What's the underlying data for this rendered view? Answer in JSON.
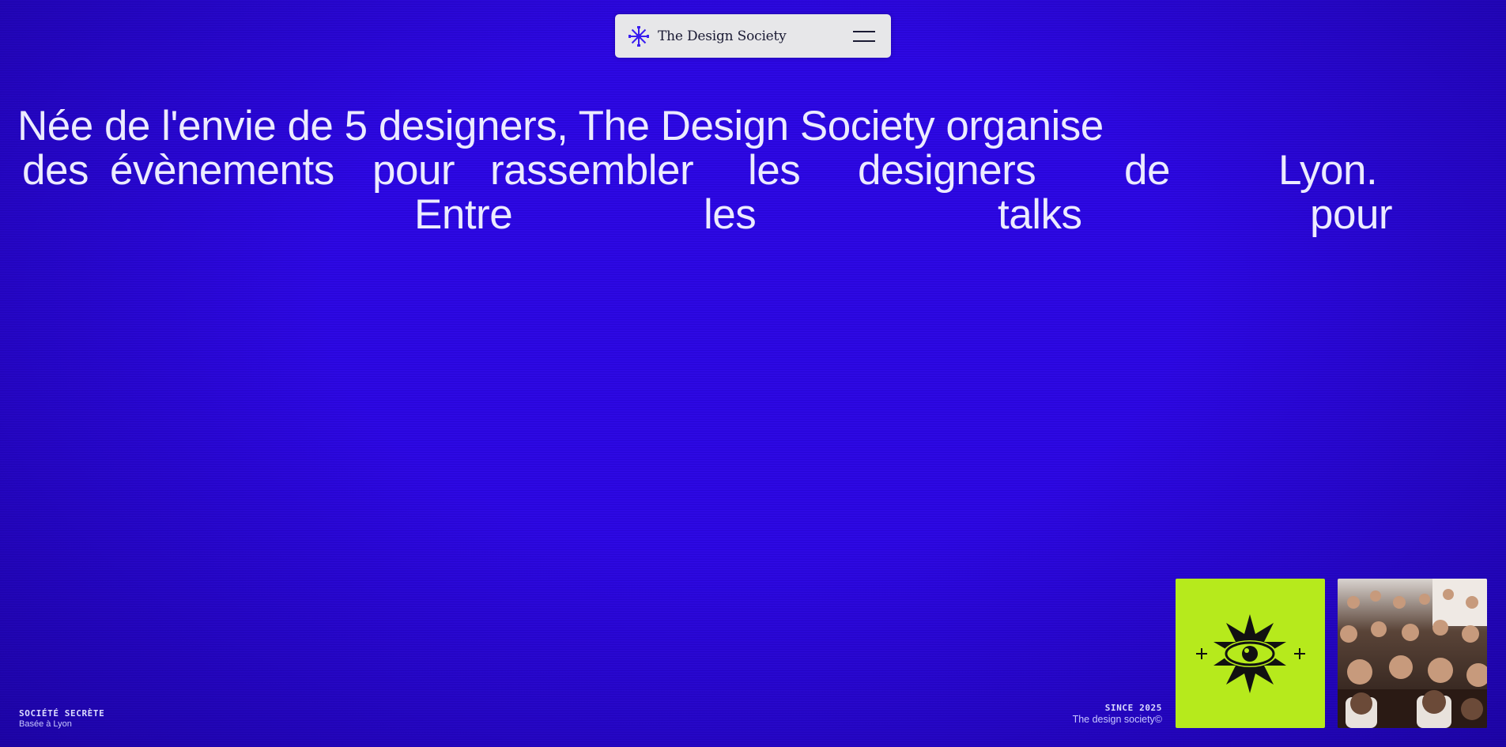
{
  "nav": {
    "brand": "The Design Society",
    "logo_icon": "snowflake-logo-icon",
    "menu_icon": "hamburger-menu-icon"
  },
  "hero": {
    "line1": "Née de l'envie de 5 designers, The Design Society organise",
    "line2_words": [
      "des",
      "évènements",
      "pour",
      "rassembler",
      "les",
      "designers",
      "de",
      "Lyon."
    ],
    "line3_words": [
      "Entre",
      "les",
      "talks",
      "pour"
    ]
  },
  "footer_left": {
    "title": "SOCIÉTÉ SECRÈTE",
    "subtitle": "Basée à Lyon"
  },
  "footer_right": {
    "since": "SINCE 2025",
    "copyright": "The design society©"
  },
  "cards": {
    "emblem_icon": "all-seeing-eye-star-icon",
    "photo": "audience-photo"
  },
  "colors": {
    "background": "#2b05e6",
    "text": "#ecebff",
    "nav_bg": "#e7e7e9",
    "accent_green": "#b6ea1c"
  }
}
